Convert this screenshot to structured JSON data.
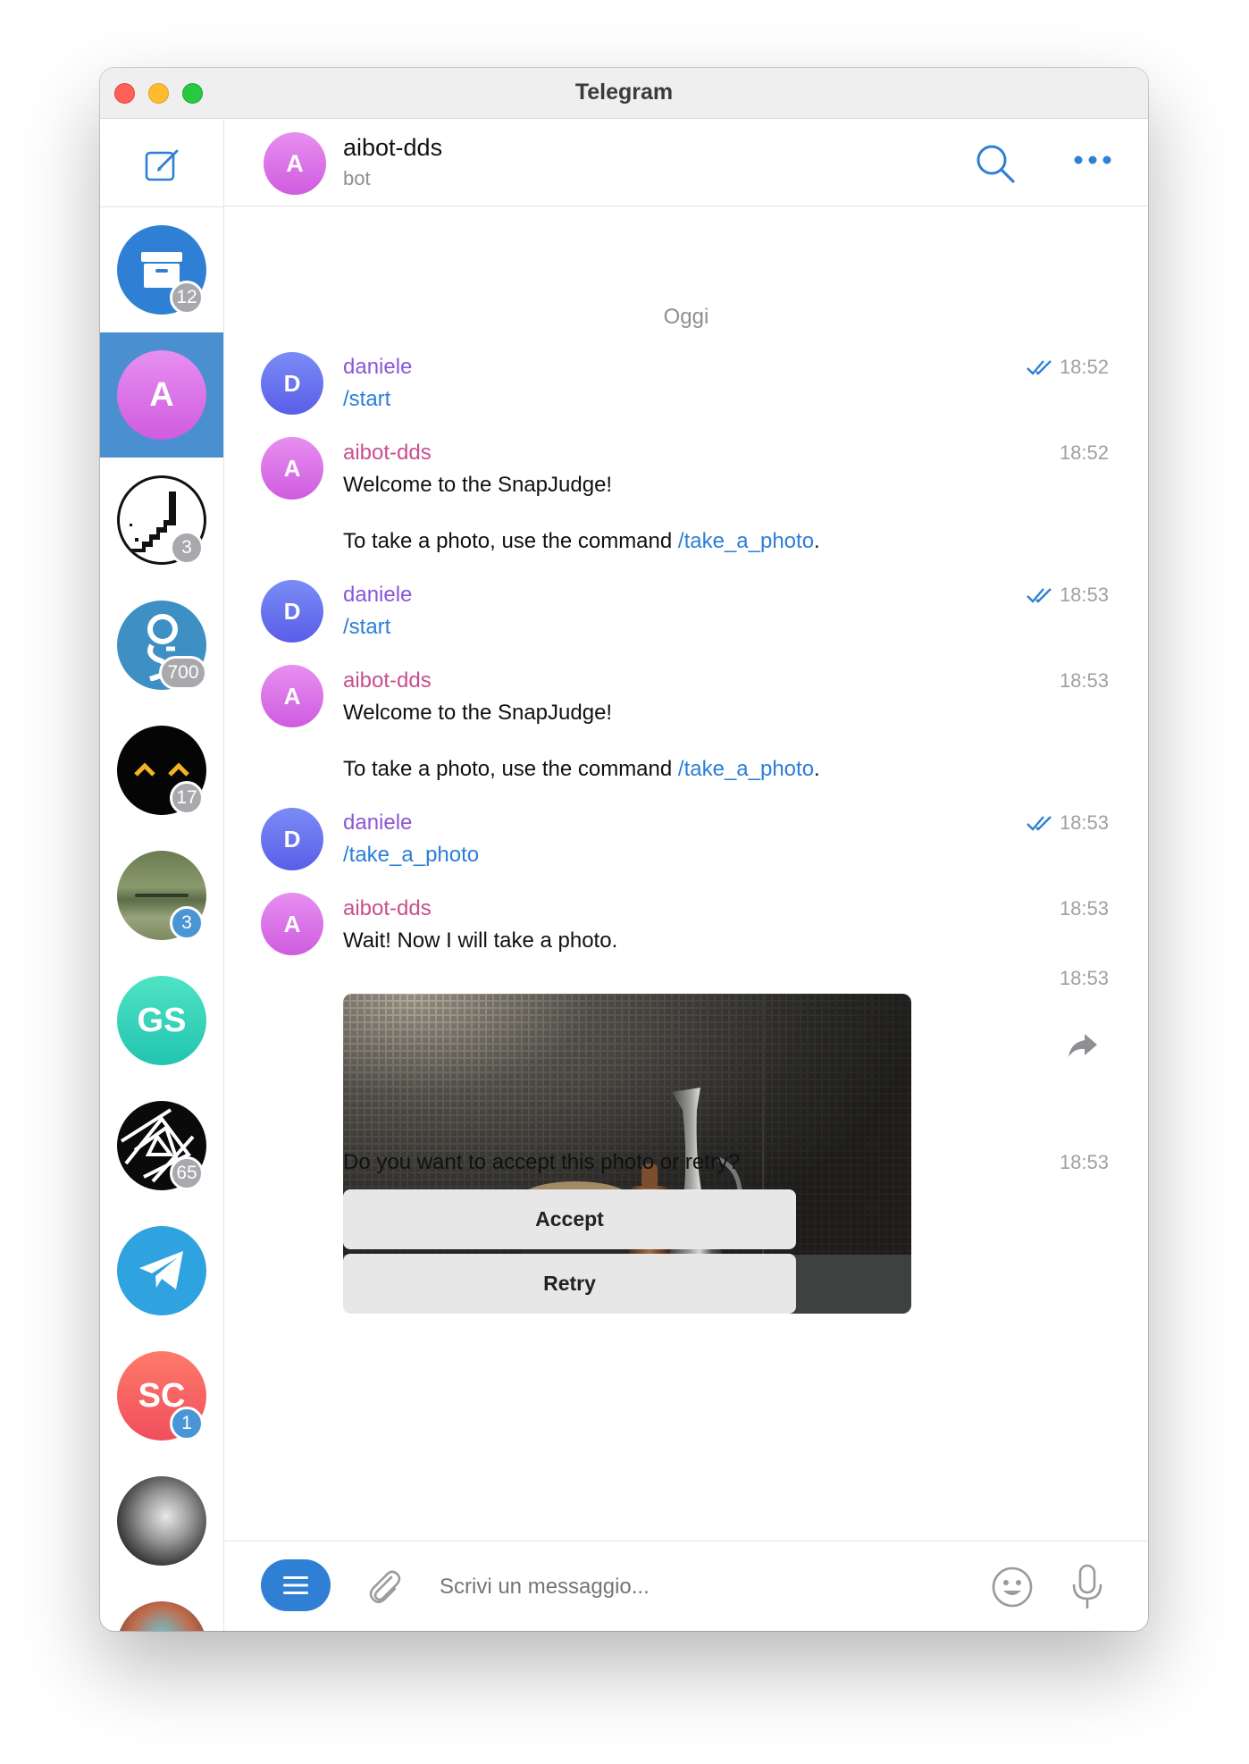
{
  "window": {
    "title": "Telegram"
  },
  "sidebar": {
    "items": [
      {
        "name": "archive",
        "badge": "12",
        "badge_style": "grey"
      },
      {
        "name": "aibot-dds",
        "initial": "A",
        "active": true
      },
      {
        "name": "chat-3",
        "badge": "3",
        "badge_style": "grey"
      },
      {
        "name": "chat-700",
        "badge": "700",
        "badge_style": "grey"
      },
      {
        "name": "chat-17",
        "badge": "17",
        "badge_style": "grey"
      },
      {
        "name": "chat-forest",
        "badge": "3",
        "badge_style": "blue"
      },
      {
        "name": "chat-gs",
        "initial": "GS"
      },
      {
        "name": "chat-65",
        "badge": "65",
        "badge_style": "grey"
      },
      {
        "name": "telegram",
        "icon": "paper-plane-icon"
      },
      {
        "name": "chat-sc",
        "initial": "SC",
        "badge": "1",
        "badge_style": "blue"
      },
      {
        "name": "chat-photo"
      },
      {
        "name": "chat-partial"
      }
    ]
  },
  "header": {
    "name": "aibot-dds",
    "subtitle": "bot",
    "initial": "A"
  },
  "date_separator": "Oggi",
  "messages": [
    {
      "sender": "daniele",
      "initial": "D",
      "time": "18:52",
      "read": true,
      "text": "/start"
    },
    {
      "sender": "aibot-dds",
      "initial": "A",
      "time": "18:52",
      "line1": "Welcome to the SnapJudge!",
      "line2_prefix": "To take a photo, use the command ",
      "line2_link": "/take_a_photo",
      "line2_suffix": "."
    },
    {
      "sender": "daniele",
      "initial": "D",
      "time": "18:53",
      "read": true,
      "text": "/start"
    },
    {
      "sender": "aibot-dds",
      "initial": "A",
      "time": "18:53",
      "line1": "Welcome to the SnapJudge!",
      "line2_prefix": "To take a photo, use the command ",
      "line2_link": "/take_a_photo",
      "line2_suffix": "."
    },
    {
      "sender": "daniele",
      "initial": "D",
      "time": "18:53",
      "read": true,
      "text": "/take_a_photo"
    },
    {
      "sender": "aibot-dds",
      "initial": "A",
      "time": "18:53",
      "text": "Wait! Now I will take a photo."
    },
    {
      "type": "photo",
      "time": "18:53"
    },
    {
      "text": "Do you want to accept this photo or retry?",
      "time": "18:53",
      "buttons": [
        "Accept",
        "Retry"
      ]
    }
  ],
  "composer": {
    "placeholder": "Scrivi un messaggio..."
  },
  "colors": {
    "accent": "#2f80d5",
    "active_chat": "#4a8fcf",
    "sender_user": "#8a56d8",
    "sender_bot": "#c94f8e"
  }
}
